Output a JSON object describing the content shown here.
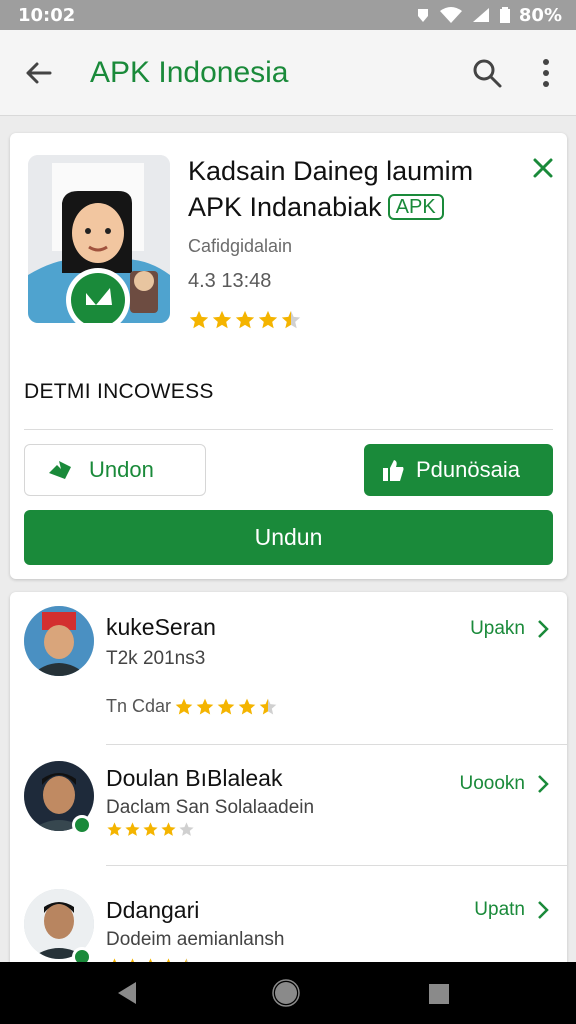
{
  "status_bar": {
    "time": "10:02",
    "battery": "80%"
  },
  "app_bar": {
    "title": "APK Indonesia"
  },
  "app_card": {
    "name": "Kadsain Daineg laumim APK Indanabiak",
    "badge": "APK",
    "category": "Cafidgidalain",
    "meta": "4.3 13:48",
    "rating": 4.5,
    "section_title": "DETMI INCOWESS",
    "button_outline": "Undon",
    "button_secondary": "Pdunösaia",
    "button_primary": "Undun"
  },
  "list": {
    "items": [
      {
        "name": "kukeSeran",
        "sub": "T2k 201ns3",
        "stars_label": "Tn Cdar",
        "rating": 4.5,
        "action": "Upakn"
      },
      {
        "name": "Doulan BıBlaleak",
        "sub": "Daclam San Solalaadein",
        "rating": 4,
        "action": "Uoookn"
      },
      {
        "name": "Ddangari",
        "sub": "Dodeim aemianlansh",
        "rating": 4.5,
        "action": "Upatn"
      }
    ]
  },
  "colors": {
    "accent": "#1a8a3a",
    "star": "#f4b400"
  }
}
